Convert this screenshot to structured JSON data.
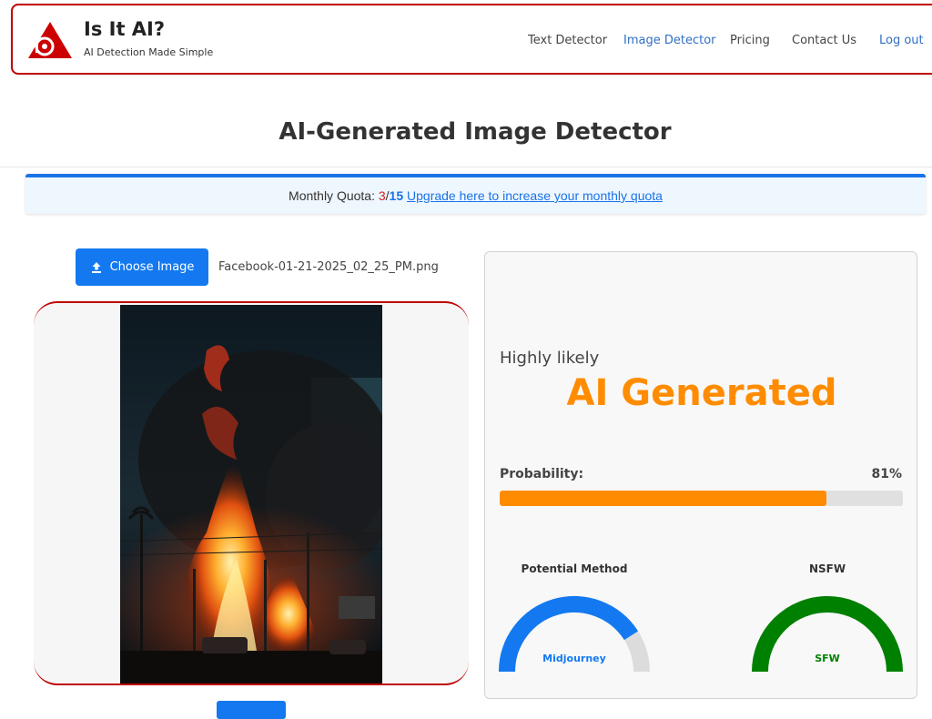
{
  "header": {
    "brand_title": "Is It AI?",
    "brand_subtitle": "AI Detection Made Simple",
    "nav": [
      {
        "label": "Text Detector",
        "active": false
      },
      {
        "label": "Image Detector",
        "active": true
      },
      {
        "label": "Pricing",
        "active": false
      },
      {
        "label": "Contact Us",
        "active": false
      },
      {
        "label": "Log out",
        "active": false
      }
    ],
    "brand_color": "#c00000"
  },
  "page": {
    "title": "AI-Generated Image Detector"
  },
  "quota": {
    "label": "Monthly Quota:",
    "used": "3",
    "separator": "/",
    "total": "15",
    "upgrade_link": "Upgrade here to increase your monthly quota"
  },
  "upload": {
    "button_label": "Choose Image",
    "icon": "upload-icon",
    "filename": "Facebook-01-21-2025_02_25_PM.png"
  },
  "result": {
    "likelihood": "Highly likely",
    "verdict": "AI Generated",
    "verdict_color": "#ff8c00",
    "probability_label": "Probability:",
    "probability_text": "81%",
    "probability": 0.81,
    "gauges": [
      {
        "title": "Potential Method",
        "label": "Midjourney",
        "level": 0.82,
        "color": "#1479f0"
      },
      {
        "title": "NSFW",
        "label": "SFW",
        "level": 1.0,
        "color": "#008000"
      }
    ]
  }
}
